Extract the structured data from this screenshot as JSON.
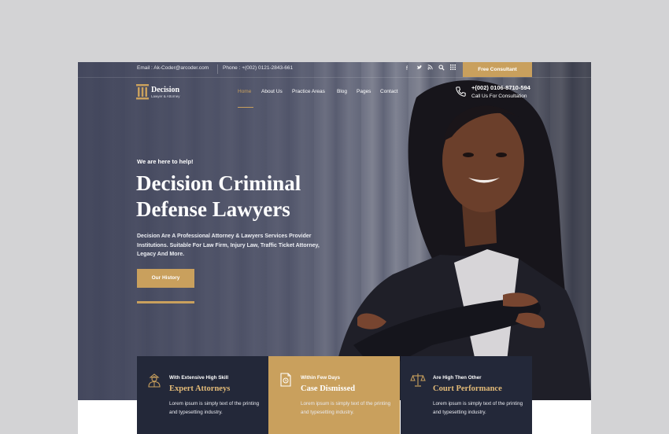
{
  "colors": {
    "accent": "#c9a05d",
    "dark_panel": "#232839",
    "page_bg": "#d3d3d5"
  },
  "topbar": {
    "email": "Email : Ak-Coder@arcoder.com",
    "phone": "Phone : +(002) 0121-2843-661",
    "social_icons": [
      "facebook-icon",
      "twitter-icon",
      "rss-icon",
      "search-icon",
      "grid-icon"
    ],
    "cta_label": "Free Consultant"
  },
  "logo": {
    "name": "Decision",
    "tagline": "Lawyer & Attorney"
  },
  "nav": {
    "items": [
      "Home",
      "About Us",
      "Practice Areas",
      "Blog",
      "Pages",
      "Contact"
    ],
    "active": "Home"
  },
  "contact": {
    "phone": "+(002) 0106-8710-594",
    "label": "Call Us For Consultation"
  },
  "hero": {
    "eyebrow": "We are here to help!",
    "title_line1": "Decision Criminal",
    "title_line2": "Defense Lawyers",
    "description": "Decision Are A Professional Attorney & Lawyers Services Provider Institutions. Suitable For Law Firm, Injury Law, Traffic Ticket Attorney, Legacy And More.",
    "button_label": "Our History"
  },
  "features": [
    {
      "label": "With Extensive High Skill",
      "title": "Expert Attorneys",
      "body": "Lorem ipsum is simply text of the printing and typesetting industry.",
      "icon": "lawyer-icon"
    },
    {
      "label": "Within Few Days",
      "title": "Case Dismissed",
      "body": "Lorem ipsum is simply text of the printing and typesetting industry.",
      "icon": "document-icon"
    },
    {
      "label": "Are High Then Other",
      "title": "Court Performance",
      "body": "Lorem ipsum is simply text of the printing and typesetting industry.",
      "icon": "scales-icon"
    }
  ]
}
